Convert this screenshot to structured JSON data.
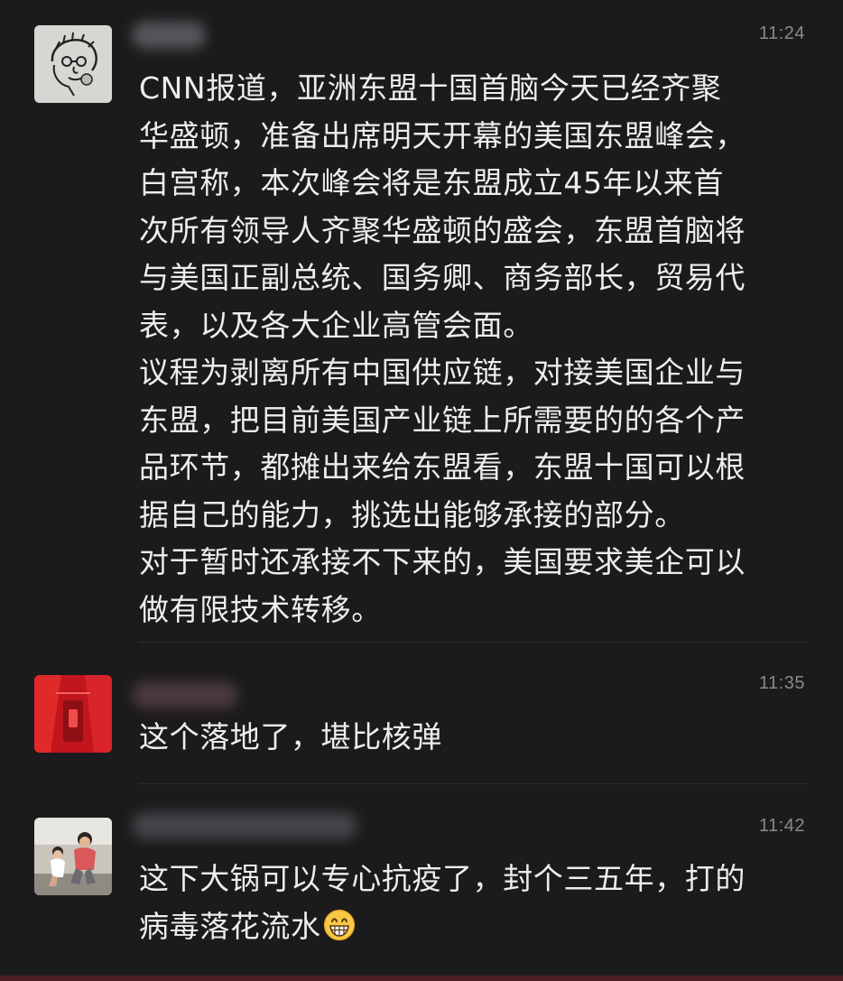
{
  "messages": [
    {
      "time": "11:24",
      "avatar_icon": "sketch-portrait-avatar-icon",
      "lines": [
        "CNN报道，亚洲东盟十国首脑今天已经齐聚",
        "华盛顿，准备出席明天开幕的美国东盟峰会，",
        "白宫称，本次峰会将是东盟成立45年以来首",
        "次所有领导人齐聚华盛顿的盛会，东盟首脑将",
        "与美国正副总统、国务卿、商务部长，贸易代",
        "表，以及各大企业高管会面。",
        "议程为剥离所有中国供应链，对接美国企业与",
        "东盟，把目前美国产业链上所需要的的各个产",
        "品环节，都摊出来给东盟看，东盟十国可以根",
        "据自己的能力，挑选出能够承接的部分。",
        "对于暂时还承接不下来的，美国要求美企可以",
        "做有限技术转移。"
      ]
    },
    {
      "time": "11:35",
      "avatar_icon": "red-abstract-avatar-icon",
      "lines": [
        "这个落地了，堪比核弹"
      ]
    },
    {
      "time": "11:42",
      "avatar_icon": "family-photo-avatar-icon",
      "lines": [
        "这下大锅可以专心抗疫了，封个三五年，打的",
        "病毒落花流水"
      ],
      "trailing_emoji": "grinning-face-emoji"
    }
  ],
  "colors": {
    "background": "#1b1a1c",
    "text": "#ededed",
    "timestamp": "#8a8a8a",
    "divider": "#2d2c2f"
  }
}
